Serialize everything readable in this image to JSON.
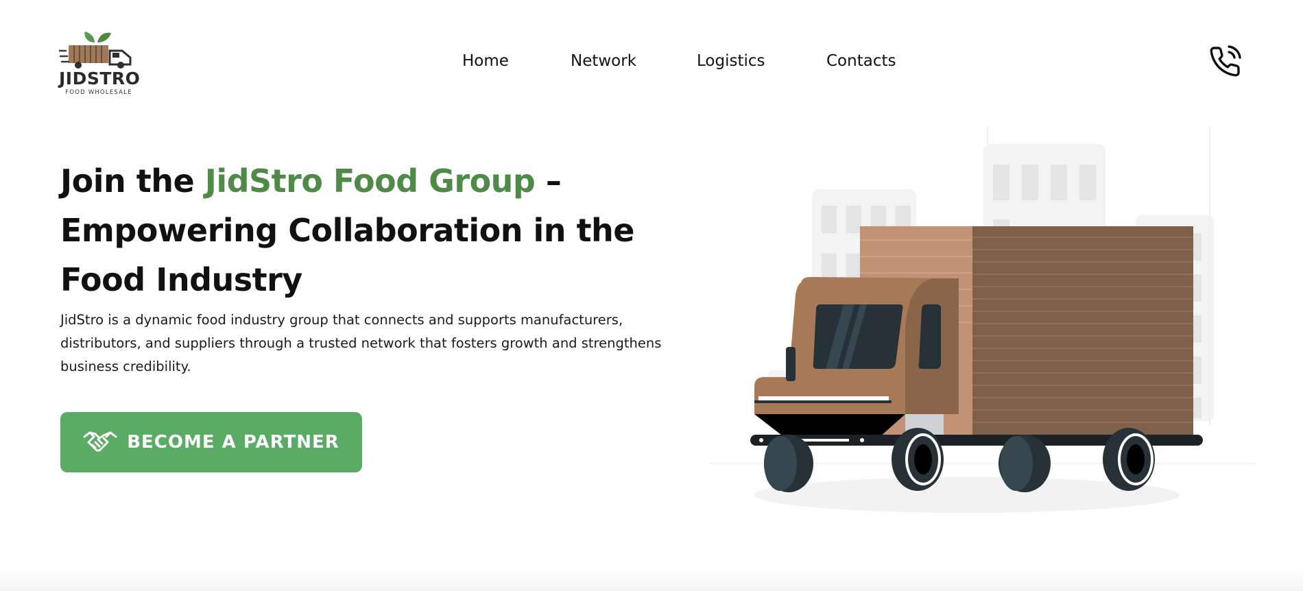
{
  "brand": {
    "name": "JIDSTRO",
    "tagline": "FOOD WHOLESALE"
  },
  "nav": {
    "items": [
      "Home",
      "Network",
      "Logistics",
      "Contacts"
    ]
  },
  "header_actions": {
    "phone_icon": "phone-call-icon"
  },
  "hero": {
    "title_part1": "Join the ",
    "title_accent": "JidStro Food Group",
    "title_part2": " – Empowering Collaboration in the Food Industry",
    "description": "JidStro is a dynamic food industry group that connects and supports manufacturers, distributors, and suppliers through a trusted network that fosters growth and strengthens business credibility.",
    "cta_label": "Become a Partner",
    "cta_icon": "handshake-icon"
  },
  "colors": {
    "accent_green": "#4f8a48",
    "button_green": "#5aab63",
    "truck_brown": "#a87957",
    "cargo_brown": "#7f6048",
    "text": "#111111"
  }
}
